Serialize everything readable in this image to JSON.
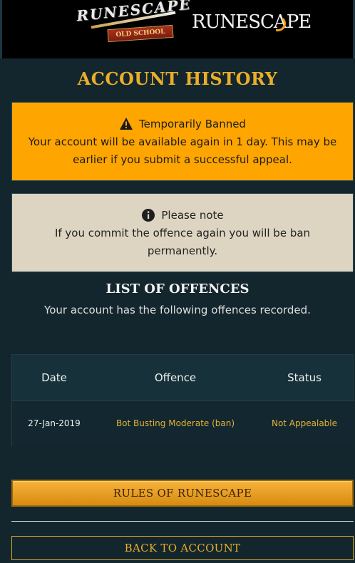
{
  "header": {
    "osrs_logo_word": "RUNESCAPE",
    "osrs_logo_banner": "OLD SCHOOL",
    "rs_logo_word": "RUNESCAPE"
  },
  "page_title": "ACCOUNT HISTORY",
  "banned_alert": {
    "icon": "warning-icon",
    "title": "Temporarily Banned",
    "body": "Your account will be available again in 1 day. This may be earlier if you submit a successful appeal.",
    "color": "#ffa500"
  },
  "note_alert": {
    "icon": "info-icon",
    "title": "Please note",
    "body": "If you commit the offence again you will be ban permanently.",
    "color": "#ddd5c1"
  },
  "offences": {
    "title": "LIST OF OFFENCES",
    "subtitle": "Your account has the following offences recorded.",
    "columns": [
      "Date",
      "Offence",
      "Status"
    ],
    "rows": [
      {
        "date": "27-Jan-2019",
        "offence": "Bot Busting Moderate (ban)",
        "status": "Not Appealable"
      }
    ]
  },
  "buttons": {
    "rules": "RULES OF RUNESCAPE",
    "back": "BACK TO ACCOUNT"
  },
  "colors": {
    "accent": "#e9ae2a",
    "background": "#13262d"
  }
}
